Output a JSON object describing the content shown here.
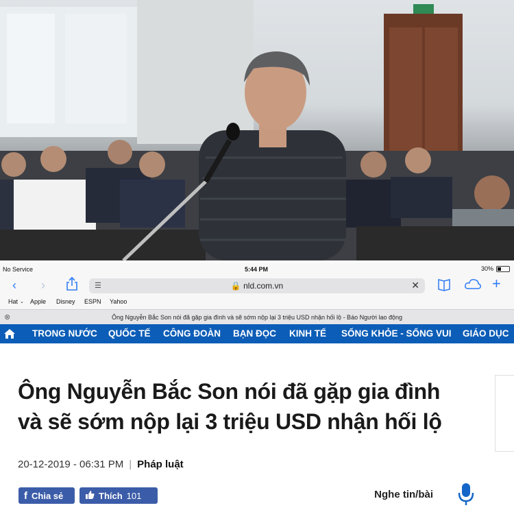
{
  "status_bar": {
    "carrier": "No Service",
    "time": "5:44 PM",
    "battery_text": "30%",
    "battery_level": 0.3
  },
  "toolbar": {
    "url": "nld.com.vn",
    "icons": [
      "back-icon",
      "forward-icon",
      "share-icon",
      "reader-icon",
      "clear-icon",
      "bookmarks-icon",
      "cloud-tabs-icon",
      "new-tab-icon"
    ]
  },
  "bookmarks": [
    "Hat",
    "Apple",
    "Disney",
    "ESPN",
    "Yahoo"
  ],
  "tab": {
    "title": "Ông Nguyễn Bắc Son nói đã gặp gia đình và sẽ sớm nộp lại 3 triệu USD nhận hối lộ - Báo Người lao động"
  },
  "nav": {
    "items": [
      "TRONG NƯỚC",
      "QUỐC TẾ",
      "CÔNG ĐOÀN",
      "BẠN ĐỌC",
      "KINH TẾ",
      "SỐNG KHỎE - SỐNG VUI",
      "GIÁO DỤC"
    ],
    "color": "#0c5db7"
  },
  "article": {
    "headline_line1": "Ông Nguyễn Bắc Son nói đã gặp gia đình",
    "headline_line2": "và sẽ sớm nộp lại 3 triệu USD nhận hối lộ",
    "date": "20-12-2019 - 06:31 PM",
    "separator": "|",
    "category": "Pháp luật",
    "share_label": "Chia sẻ",
    "like_label": "Thích",
    "like_count": "101",
    "listen_label": "Nghe tin/bài",
    "button_color": "#3b5ca8"
  }
}
